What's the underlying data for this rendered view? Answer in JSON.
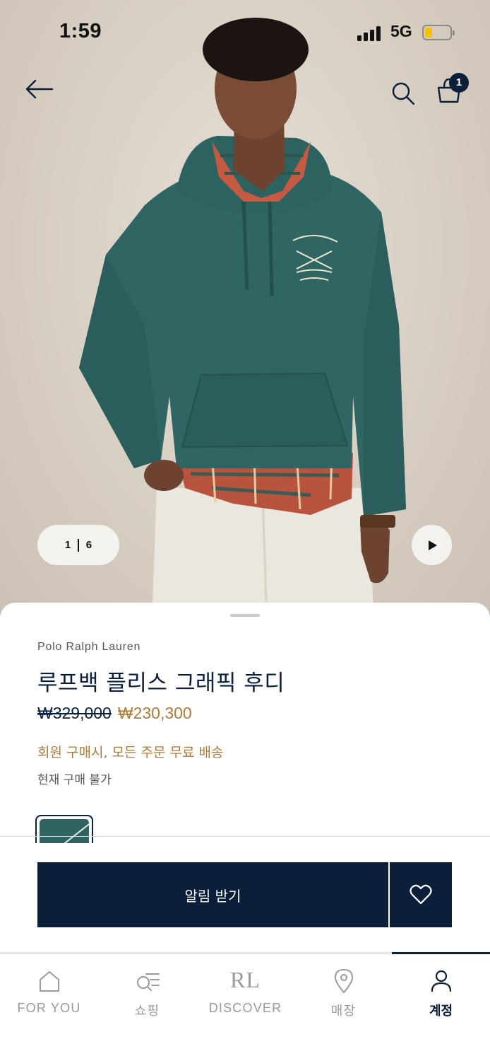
{
  "status_bar": {
    "time": "1:59",
    "network": "5G"
  },
  "header": {
    "cart_count": "1"
  },
  "gallery": {
    "current": "1",
    "total": "6"
  },
  "product": {
    "brand": "Polo Ralph Lauren",
    "title": "루프백 플리스 그래픽 후디",
    "original_price": "₩329,000",
    "sale_price": "₩230,300",
    "promo": "회원 구매시, 모든 주문 무료 배송",
    "availability": "현재 구매 불가",
    "swatch_color": "#2e6563"
  },
  "actions": {
    "notify_label": "알림 받기"
  },
  "tabbar": {
    "items": [
      {
        "label": "FOR YOU",
        "icon": "home-icon"
      },
      {
        "label": "쇼핑",
        "icon": "shop-search-icon"
      },
      {
        "label": "DISCOVER",
        "icon": "rl-logo-icon",
        "mark": "RL"
      },
      {
        "label": "매장",
        "icon": "location-pin-icon"
      },
      {
        "label": "계정",
        "icon": "person-icon",
        "active": true
      }
    ]
  },
  "colors": {
    "navy": "#0b1f3a",
    "gold": "#a87c3f",
    "hoodie_teal": "#2e6563"
  }
}
